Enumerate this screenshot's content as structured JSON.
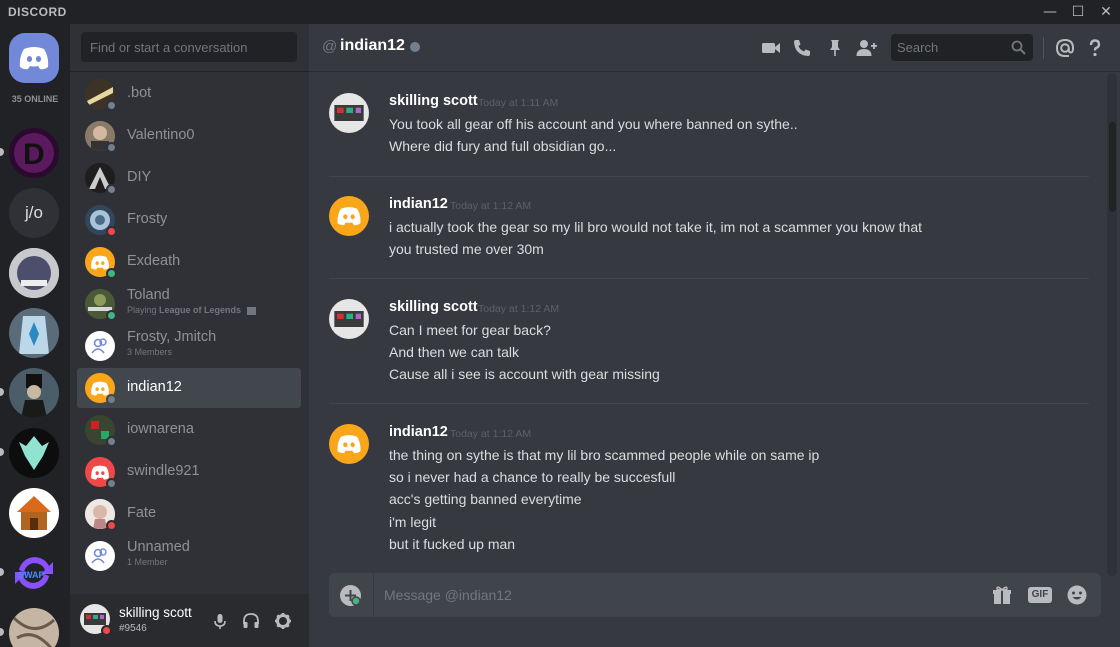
{
  "window": {
    "brand": "DISCORD",
    "controls": [
      "—",
      "☐",
      "✕"
    ]
  },
  "guilds": {
    "online_count": "35 ONLINE",
    "jo_label": "j/o"
  },
  "dm": {
    "search_placeholder": "Find or start a conversation",
    "items": [
      {
        "name": ".bot",
        "sub": ""
      },
      {
        "name": "Valentino0",
        "sub": ""
      },
      {
        "name": "DIY",
        "sub": ""
      },
      {
        "name": "Frosty",
        "sub": ""
      },
      {
        "name": "Exdeath",
        "sub": ""
      },
      {
        "name": "Toland",
        "sub_prefix": "Playing ",
        "sub_game": "League of Legends"
      },
      {
        "name": "Frosty, Jmitch",
        "sub": "3 Members"
      },
      {
        "name": "indian12",
        "sub": ""
      },
      {
        "name": "iownarena",
        "sub": ""
      },
      {
        "name": "swindle921",
        "sub": ""
      },
      {
        "name": "Fate",
        "sub": ""
      },
      {
        "name": "Unnamed",
        "sub": "1 Member"
      }
    ]
  },
  "user_panel": {
    "name": "skilling scott",
    "tag": "#9546"
  },
  "header": {
    "at": "@",
    "name": "indian12",
    "search_placeholder": "Search"
  },
  "messages": [
    {
      "author": "skilling scott",
      "time": "Today at 1:11 AM",
      "lines": [
        "You took all gear off his account and you where banned on sythe..",
        "Where did fury and full obsidian go..."
      ]
    },
    {
      "author": "indian12",
      "time": "Today at 1:12 AM",
      "lines": [
        "i actually took the gear so my lil bro would not take it, im not a scammer you know that",
        "you trusted me over 30m"
      ]
    },
    {
      "author": "skilling scott",
      "time": "Today at 1:12 AM",
      "lines": [
        "Can I meet for gear back?",
        "And then we can talk",
        "Cause all i see is account with gear missing"
      ]
    },
    {
      "author": "indian12",
      "time": "Today at 1:12 AM",
      "lines": [
        "the thing on sythe is that my lil bro scammed people while on same ip",
        "so i never had a chance to really be succesfull",
        "acc's getting banned everytime",
        "i'm legit",
        "but it fucked up man"
      ]
    }
  ],
  "composer": {
    "placeholder": "Message @indian12",
    "gif_label": "GIF"
  },
  "colors": {
    "blurple": "#7289da",
    "online": "#43b581",
    "dnd": "#f04747",
    "offline": "#747f8d",
    "orange": "#faa61a"
  }
}
